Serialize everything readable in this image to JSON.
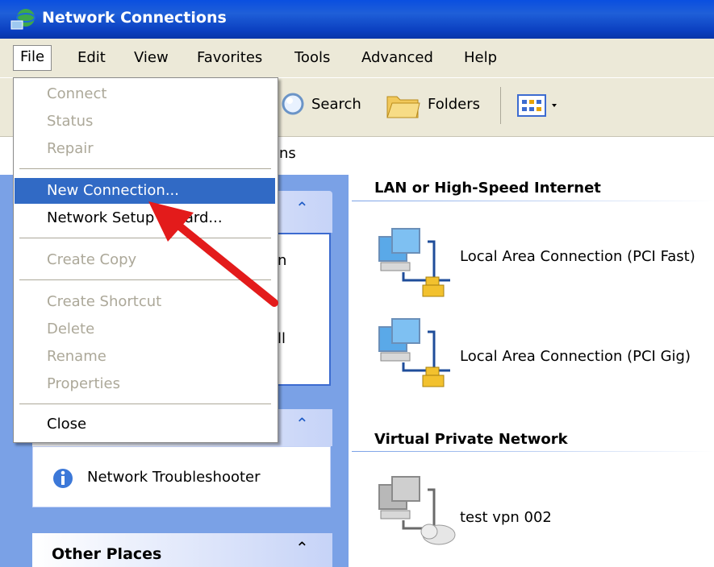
{
  "window": {
    "title": "Network Connections"
  },
  "menubar": [
    "File",
    "Edit",
    "View",
    "Favorites",
    "Tools",
    "Advanced",
    "Help"
  ],
  "toolbar": {
    "search_label": "Search",
    "folders_label": "Folders"
  },
  "address": {
    "visible_text": "ns"
  },
  "file_menu": {
    "items": [
      {
        "label": "Connect",
        "enabled": false
      },
      {
        "label": "Status",
        "enabled": false
      },
      {
        "label": "Repair",
        "enabled": false
      },
      {
        "label": "New Connection...",
        "enabled": true,
        "selected": true
      },
      {
        "label": "Network Setup Wizard...",
        "enabled": true
      },
      {
        "label": "Create Copy",
        "enabled": false
      },
      {
        "label": "Create Shortcut",
        "enabled": false
      },
      {
        "label": "Delete",
        "enabled": false
      },
      {
        "label": "Rename",
        "enabled": false
      },
      {
        "label": "Properties",
        "enabled": false
      },
      {
        "label": "Close",
        "enabled": true
      }
    ]
  },
  "left_pane": {
    "peek_text": [
      "n",
      "ll"
    ],
    "troubleshoot_link": "Network Troubleshooter",
    "other_places_title": "Other Places"
  },
  "content": {
    "groups": [
      {
        "title": "LAN or High-Speed Internet",
        "items": [
          {
            "label": "Local Area Connection (PCI Fast)"
          },
          {
            "label": "Local Area Connection (PCI Gig)"
          }
        ]
      },
      {
        "title": "Virtual Private Network",
        "items": [
          {
            "label": "test vpn 002"
          }
        ]
      }
    ]
  },
  "colors": {
    "titlebar": "#0a4fe0",
    "menu_highlight": "#316ac5",
    "arrow": "#e31b1b",
    "taskpane": "#7aa1e6"
  }
}
